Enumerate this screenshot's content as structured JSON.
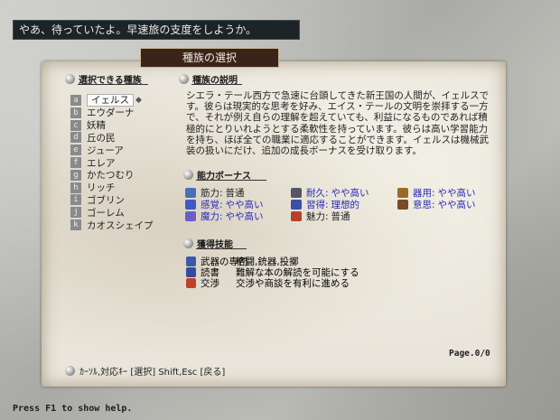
{
  "message": "やあ、待っていたよ。早速旅の支度をしようか。",
  "panel_title": "種族の選択",
  "race_list": {
    "header": "選択できる種族",
    "items": [
      {
        "letter": "a",
        "name": "イェルス",
        "selected": true
      },
      {
        "letter": "b",
        "name": "エウダーナ"
      },
      {
        "letter": "c",
        "name": "妖精"
      },
      {
        "letter": "d",
        "name": "丘の民"
      },
      {
        "letter": "e",
        "name": "ジューア"
      },
      {
        "letter": "f",
        "name": "エレア"
      },
      {
        "letter": "g",
        "name": "かたつむり"
      },
      {
        "letter": "h",
        "name": "リッチ"
      },
      {
        "letter": "i",
        "name": "ゴブリン"
      },
      {
        "letter": "j",
        "name": "ゴーレム"
      },
      {
        "letter": "k",
        "name": "カオスシェイプ"
      }
    ]
  },
  "description": {
    "header": "種族の説明",
    "text": "シエラ・テール西方で急速に台頭してきた新王国の人間が、イェルスです。彼らは現実的な思考を好み、エイス・テールの文明を崇拝する一方で、それが例え自らの理解を超えていても、利益になるものであれば積極的にとりいれようとする柔軟性を持っています。彼らは高い学習能力を持ち、ほぼ全ての職業に適応することができます。イェルスは機械武装の扱いにだけ、追加の成長ボーナスを受け取ります。"
  },
  "bonus": {
    "header": "能力ボーナス",
    "stats": [
      {
        "label": "筋力:",
        "value": "普通",
        "icon": "strength-icon",
        "color": "#222222"
      },
      {
        "label": "感覚:",
        "value": "やや高い",
        "icon": "perception-icon",
        "color": "#2a2ab8"
      },
      {
        "label": "魔力:",
        "value": "やや高い",
        "icon": "magic-icon",
        "color": "#2a2ab8"
      },
      {
        "label": "耐久:",
        "value": "やや高い",
        "icon": "constitution-icon",
        "color": "#2a2ab8"
      },
      {
        "label": "習得:",
        "value": "理想的",
        "icon": "learning-icon",
        "color": "#2a2ab8"
      },
      {
        "label": "魅力:",
        "value": "普通",
        "icon": "charisma-icon",
        "color": "#222222"
      },
      {
        "label": "器用:",
        "value": "やや高い",
        "icon": "dexterity-icon",
        "color": "#2a2ab8"
      },
      {
        "label": "意思:",
        "value": "やや高い",
        "icon": "will-icon",
        "color": "#2a2ab8"
      }
    ]
  },
  "skills": {
    "header": "獲得技能",
    "items": [
      {
        "name": "武器の専門",
        "desc": "格闘,銃器,投擲",
        "icon": "weapon-icon"
      },
      {
        "name": "読書",
        "desc": "難解な本の解読を可能にする",
        "icon": "book-icon"
      },
      {
        "name": "交渉",
        "desc": "交渉や商談を有利に進める",
        "icon": "negotiation-icon"
      }
    ]
  },
  "page_indicator": "Page.0/0",
  "controls_hint": "ｶｰｿﾙ,対応ｷｰ [選択]  Shift,Esc [戻る]",
  "help_text": "Press F1 to show help."
}
